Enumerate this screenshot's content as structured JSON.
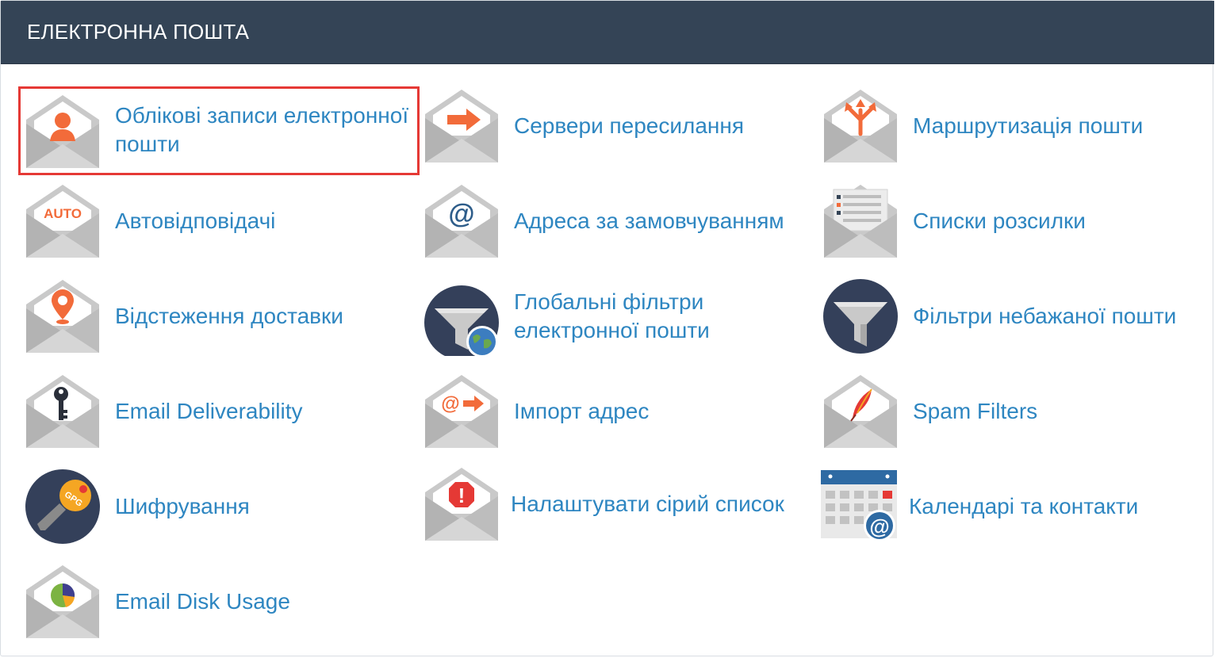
{
  "header": {
    "title": "ЕЛЕКТРОННА ПОШТА"
  },
  "items": [
    {
      "label": "Облікові записи електронної пошти",
      "icon": "email-accounts-icon",
      "highlighted": true
    },
    {
      "label": "Сервери пересилання",
      "icon": "forwarders-icon"
    },
    {
      "label": "Маршрутизація пошти",
      "icon": "email-routing-icon"
    },
    {
      "label": "Автовідповідачі",
      "icon": "autoresponders-icon",
      "badge": "AUTO"
    },
    {
      "label": "Адреса за замовчуванням",
      "icon": "default-address-icon",
      "badge": "@"
    },
    {
      "label": "Списки розсилки",
      "icon": "mailing-lists-icon"
    },
    {
      "label": "Відстеження доставки",
      "icon": "track-delivery-icon"
    },
    {
      "label": "Глобальні фільтри електронної пошти",
      "icon": "global-email-filters-icon"
    },
    {
      "label": "Фільтри небажаної пошти",
      "icon": "email-filters-icon"
    },
    {
      "label": "Email Deliverability",
      "icon": "email-deliverability-icon"
    },
    {
      "label": "Імпорт адрес",
      "icon": "address-importer-icon",
      "badge": "@"
    },
    {
      "label": "Spam Filters",
      "icon": "spam-filters-icon"
    },
    {
      "label": "Шифрування",
      "icon": "encryption-icon",
      "badge": "GPG"
    },
    {
      "label": "Налаштувати сірий список",
      "icon": "greylisting-icon",
      "badge": "!"
    },
    {
      "label": "Календарі та контакти",
      "icon": "calendars-contacts-icon",
      "badge": "@"
    },
    {
      "label": "Email Disk Usage",
      "icon": "email-disk-usage-icon"
    }
  ],
  "colors": {
    "header_bg": "#344456",
    "link": "#2e86c1",
    "accent_orange": "#f26b3a",
    "envelope_gray": "#c7c7c7",
    "highlight_red": "#e53935",
    "dark_circle": "#34405a"
  }
}
